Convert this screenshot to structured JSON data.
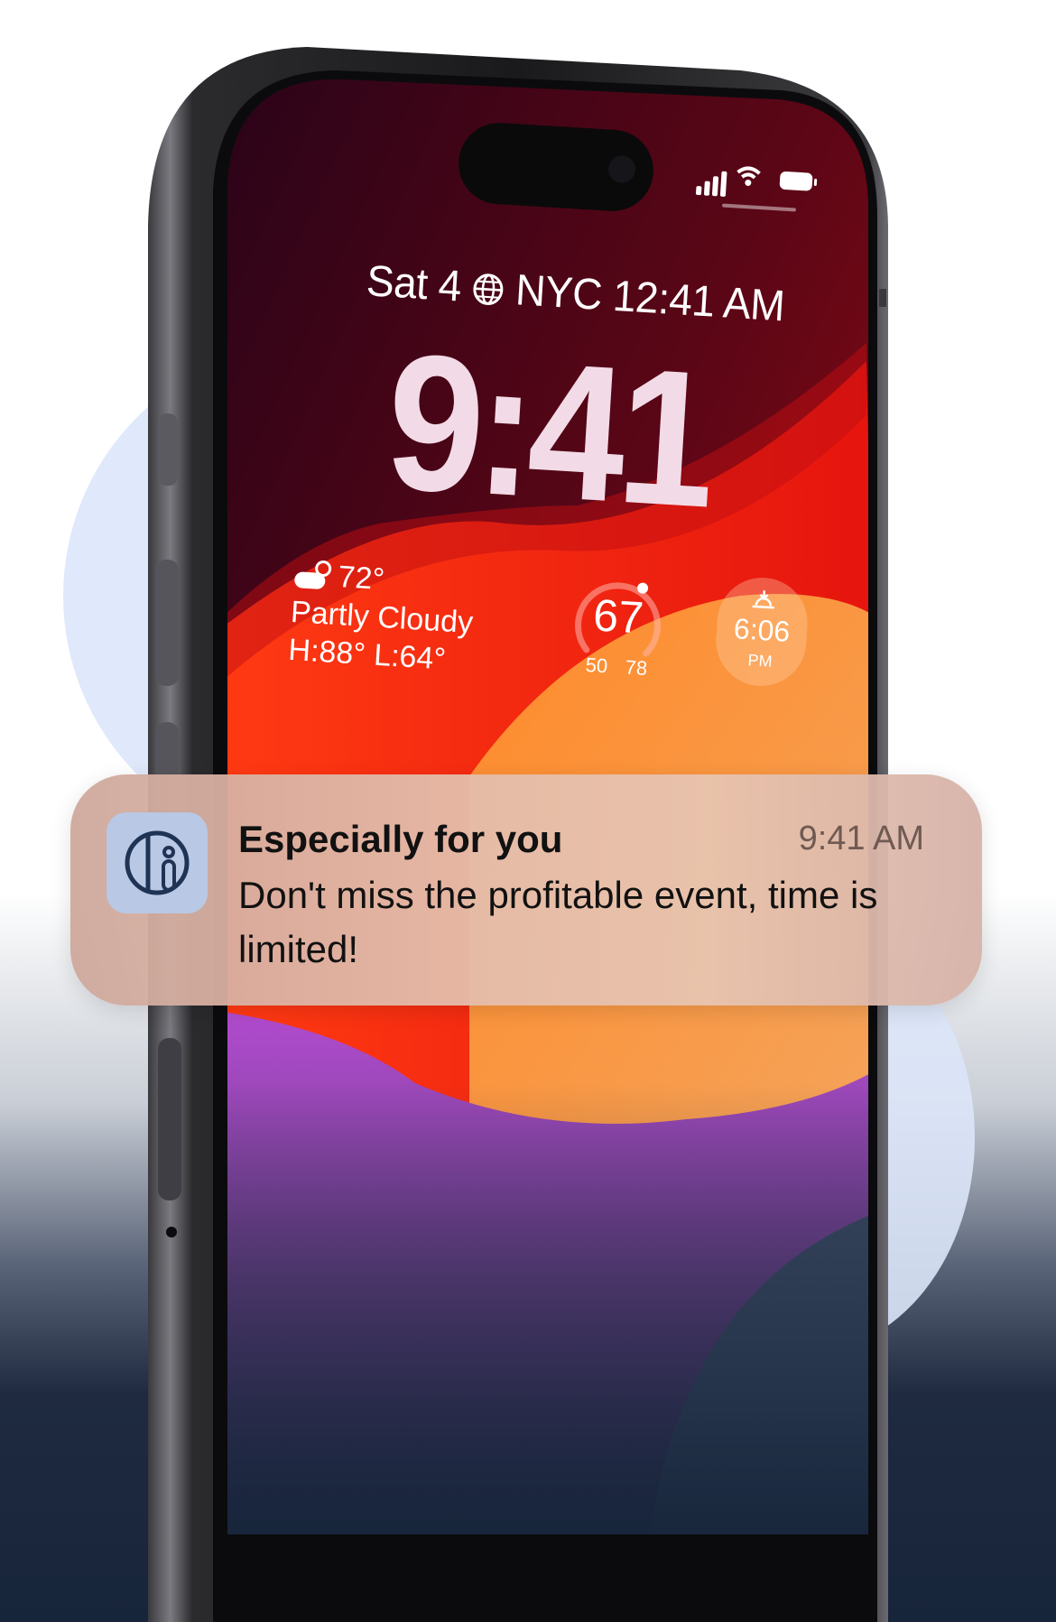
{
  "lockscreen": {
    "date_prefix": "Sat 4",
    "location_time": "NYC 12:41 AM",
    "time": "9:41",
    "weather": {
      "temp": "72°",
      "condition": "Partly Cloudy",
      "range": "H:88° L:64°"
    },
    "gauge": {
      "value": "67",
      "low": "50",
      "high": "78"
    },
    "sunset": {
      "time": "6:06",
      "period": "PM"
    }
  },
  "notification": {
    "title": "Especially for you",
    "time": "9:41 AM",
    "body": "Don't miss the profitable event, time is limited!"
  },
  "colors": {
    "notification_icon_bg": "#b9c8e4",
    "icon_stroke": "#1f3355",
    "page_bottom": "#17253b"
  }
}
